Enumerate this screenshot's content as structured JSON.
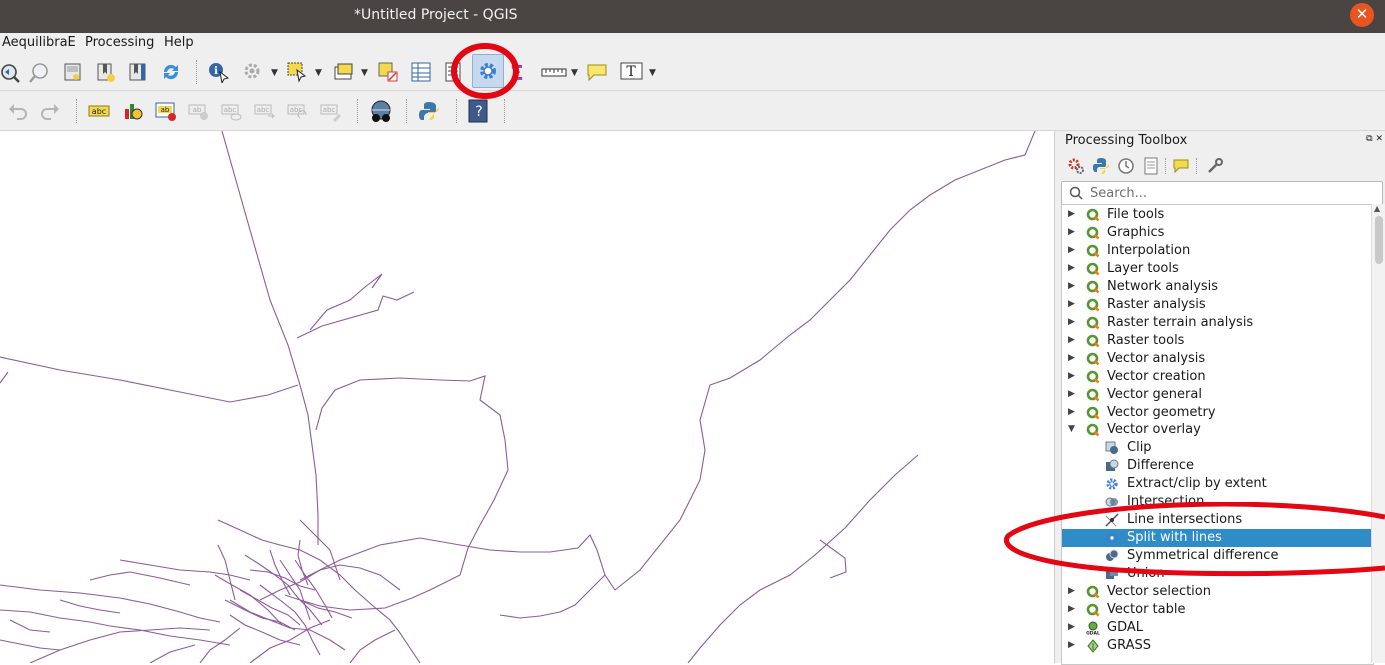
{
  "window": {
    "title": "*Untitled Project - QGIS"
  },
  "menubar": {
    "items": [
      "AequilibraE",
      "Processing",
      "Help"
    ]
  },
  "toolbar": {
    "row1_icons": [
      "pan-to-selection-icon",
      "zoom-to-selection-icon",
      "new-bookmark-icon",
      "new-spatial-bookmark-icon",
      "show-bookmarks-icon",
      "refresh-icon",
      "identify-features-icon",
      "run-feature-action-icon",
      "select-features-icon",
      "open-attribute-table-icon",
      "deselect-all-icon",
      "open-field-calculator-icon",
      "statistical-summary-icon",
      "processing-toolbox-icon",
      "sigma-icon",
      "measure-line-icon",
      "map-tips-icon",
      "text-annotation-icon"
    ],
    "row2_icons": [
      "undo-icon",
      "redo-icon",
      "label-toolbar-icon",
      "layer-diagram-icon",
      "highlight-pinned-labels-icon",
      "pin-labels-icon",
      "show-hide-labels-icon",
      "move-label-icon",
      "rotate-label-icon",
      "change-label-properties-icon",
      "mapillary-icon",
      "python-console-icon",
      "help-icon"
    ]
  },
  "toolbox": {
    "title": "Processing Toolbox",
    "toolbar_icons": [
      "models-icon",
      "scripts-icon",
      "history-icon",
      "results-viewer-icon",
      "edit-features-in-place-icon",
      "options-icon"
    ],
    "search": {
      "placeholder": "Search...",
      "value": ""
    },
    "groups_before": [
      "File tools",
      "Graphics",
      "Interpolation",
      "Layer tools",
      "Network analysis",
      "Raster analysis",
      "Raster terrain analysis",
      "Raster tools",
      "Vector analysis",
      "Vector creation",
      "Vector general",
      "Vector geometry"
    ],
    "expanded_group": "Vector overlay",
    "children": [
      {
        "label": "Clip",
        "icon": "clip-icon",
        "selected": false
      },
      {
        "label": "Difference",
        "icon": "difference-icon",
        "selected": false
      },
      {
        "label": "Extract/clip by extent",
        "icon": "gear-icon",
        "selected": false
      },
      {
        "label": "Intersection",
        "icon": "intersection-icon",
        "selected": false
      },
      {
        "label": "Line intersections",
        "icon": "line-intersections-icon",
        "selected": false
      },
      {
        "label": "Split with lines",
        "icon": "gear-icon",
        "selected": true
      },
      {
        "label": "Symmetrical difference",
        "icon": "symmetrical-difference-icon",
        "selected": false
      },
      {
        "label": "Union",
        "icon": "union-icon",
        "selected": false
      }
    ],
    "groups_after": [
      {
        "label": "Vector selection",
        "icon": "qgis-icon"
      },
      {
        "label": "Vector table",
        "icon": "qgis-icon"
      },
      {
        "label": "GDAL",
        "icon": "gdal-icon"
      },
      {
        "label": "GRASS",
        "icon": "grass-icon"
      }
    ]
  },
  "colors": {
    "selection": "#308cc6",
    "annotation": "#e30613",
    "map_lines": "#8e5a9b",
    "titlebar": "#4a4543",
    "close_button": "#e95420"
  }
}
